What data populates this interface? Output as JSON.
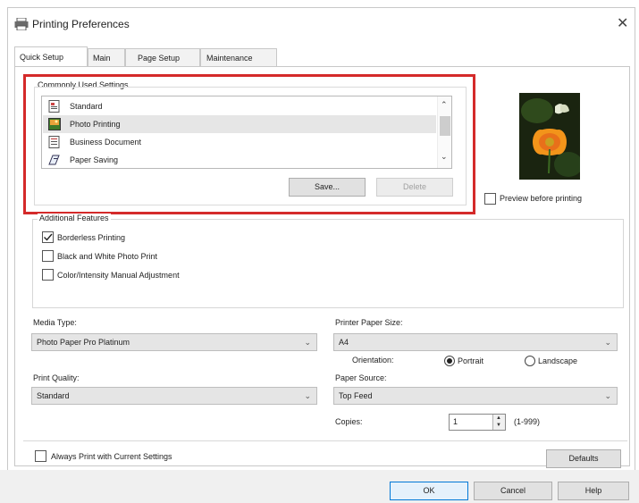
{
  "window": {
    "title": "Printing Preferences",
    "close_glyph": "✕"
  },
  "tabs": [
    {
      "label": "Quick Setup"
    },
    {
      "label": "Main"
    },
    {
      "label": "Page Setup"
    },
    {
      "label": "Maintenance"
    }
  ],
  "common": {
    "label": "Commonly Used Settings",
    "items": [
      {
        "label": "Standard",
        "icon": "standard-doc-icon"
      },
      {
        "label": "Photo Printing",
        "icon": "photo-icon"
      },
      {
        "label": "Business Document",
        "icon": "business-doc-icon"
      },
      {
        "label": "Paper Saving",
        "icon": "paper-saving-icon"
      }
    ],
    "selected_index": 1,
    "save_label": "Save...",
    "delete_label": "Delete"
  },
  "preview": {
    "label": "Preview before printing",
    "checked": false
  },
  "features": {
    "label": "Additional Features",
    "items": [
      {
        "label": "Borderless Printing",
        "checked": true
      },
      {
        "label": "Black and White Photo Print",
        "checked": false
      },
      {
        "label": "Color/Intensity Manual Adjustment",
        "checked": false
      }
    ]
  },
  "media_type": {
    "label": "Media Type:",
    "value": "Photo Paper Pro Platinum"
  },
  "print_quality": {
    "label": "Print Quality:",
    "value": "Standard"
  },
  "paper_size": {
    "label": "Printer Paper Size:",
    "value": "A4"
  },
  "orientation": {
    "label": "Orientation:",
    "portrait": "Portrait",
    "landscape": "Landscape",
    "selected": "Portrait"
  },
  "paper_source": {
    "label": "Paper Source:",
    "value": "Top Feed"
  },
  "copies": {
    "label": "Copies:",
    "value": "1",
    "range": "(1-999)"
  },
  "always_print": {
    "label": "Always Print with Current Settings",
    "checked": false
  },
  "buttons": {
    "defaults": "Defaults",
    "ok": "OK",
    "cancel": "Cancel",
    "help": "Help"
  },
  "colors": {
    "highlight_frame": "#d42a2a",
    "selected_row": "#e6e6e6"
  }
}
